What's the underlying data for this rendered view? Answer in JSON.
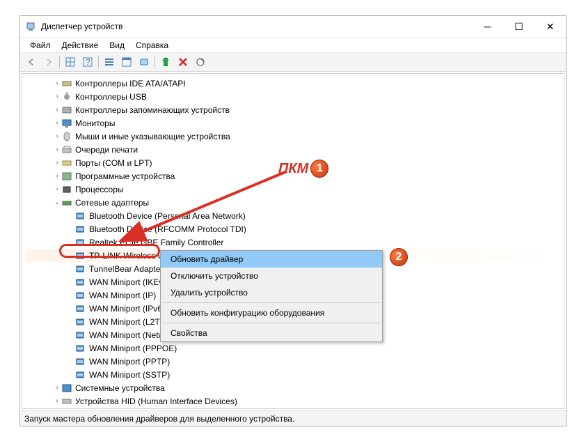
{
  "window": {
    "title": "Диспетчер устройств"
  },
  "menubar": {
    "file": "Файл",
    "action": "Действие",
    "view": "Вид",
    "help": "Справка"
  },
  "tree": {
    "categories": [
      {
        "label": "Контроллеры IDE ATA/ATAPI",
        "icon": "ide",
        "expanded": false
      },
      {
        "label": "Контроллеры USB",
        "icon": "usb",
        "expanded": false
      },
      {
        "label": "Контроллеры запоминающих устройств",
        "icon": "storage",
        "expanded": false
      },
      {
        "label": "Мониторы",
        "icon": "monitor",
        "expanded": false
      },
      {
        "label": "Мыши и иные указывающие устройства",
        "icon": "mouse",
        "expanded": false
      },
      {
        "label": "Очереди печати",
        "icon": "printer",
        "expanded": false
      },
      {
        "label": "Порты (COM и LPT)",
        "icon": "port",
        "expanded": false
      },
      {
        "label": "Программные устройства",
        "icon": "software",
        "expanded": false
      },
      {
        "label": "Процессоры",
        "icon": "cpu",
        "expanded": false
      },
      {
        "label": "Сетевые адаптеры",
        "icon": "network",
        "expanded": true
      },
      {
        "label": "Системные устройства",
        "icon": "system",
        "expanded": false
      },
      {
        "label": "Устройства HID (Human Interface Devices)",
        "icon": "hid",
        "expanded": false
      }
    ],
    "adapters": [
      "Bluetooth Device (Personal Area Network)",
      "Bluetooth Device (RFCOMM Protocol TDI)",
      "Realtek PCIe GBE Family Controller",
      "TP-LINK Wireless USB Adapter",
      "TunnelBear Adapter V9",
      "WAN Miniport (IKEv2)",
      "WAN Miniport (IP)",
      "WAN Miniport (IPv6)",
      "WAN Miniport (L2TP)",
      "WAN Miniport (Network Monitor)",
      "WAN Miniport (PPPOE)",
      "WAN Miniport (PPTP)",
      "WAN Miniport (SSTP)"
    ]
  },
  "context_menu": {
    "update": "Обновить драйвер",
    "disable": "Отключить устройство",
    "remove": "Удалить устройство",
    "refresh_config": "Обновить конфигурацию оборудования",
    "properties": "Свойства"
  },
  "statusbar": {
    "text": "Запуск мастера обновления драйверов для выделенного устройства."
  },
  "annotations": {
    "pkm": "ПКМ",
    "marker1": "1",
    "marker2": "2"
  }
}
